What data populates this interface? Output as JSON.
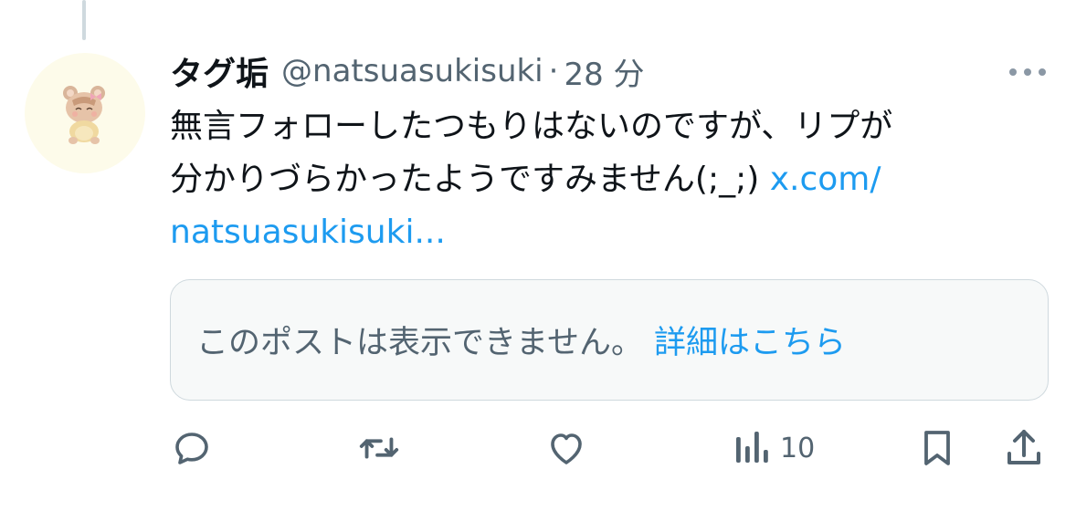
{
  "tweet": {
    "display_name": "タグ垢",
    "handle": "@natsuasukisuki",
    "separator": "·",
    "time": "28 分",
    "text_line1": "無言フォローしたつもりはないのですが、リプが",
    "text_line2": "分かりづらかったようですみません(;_;) ",
    "link_part1": "x.com/",
    "link_part2": "natsuasukisuki..."
  },
  "quote": {
    "unavailable_text": "このポストは表示できません。",
    "learn_more_label": "詳細はこちら"
  },
  "actions": {
    "reply_icon": "reply-icon",
    "repost_icon": "repost-icon",
    "like_icon": "like-icon",
    "views_icon": "views-icon",
    "views_count": "10",
    "bookmark_icon": "bookmark-icon",
    "share_icon": "share-icon"
  },
  "colors": {
    "accent": "#1d9bf0",
    "secondary_text": "#536471",
    "border": "#cfd9de"
  }
}
